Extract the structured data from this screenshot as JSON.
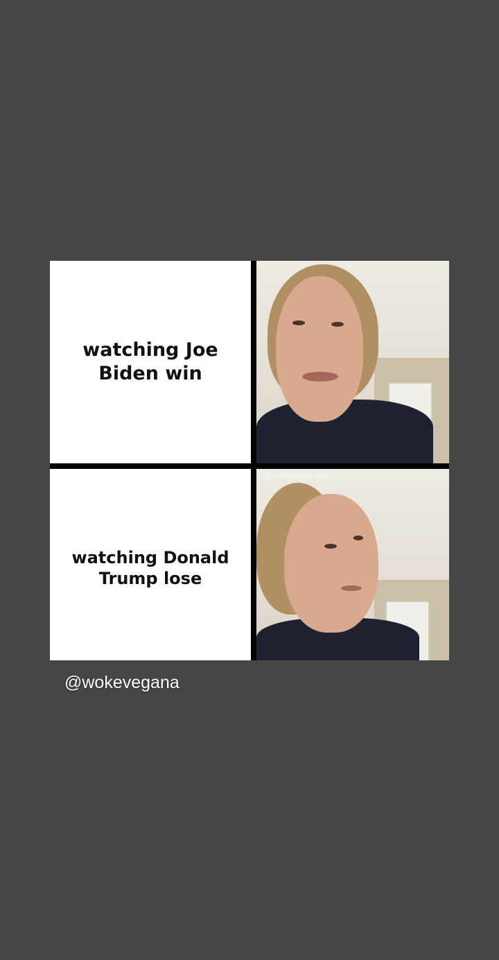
{
  "meme": {
    "top_caption": "watching Joe Biden win",
    "bottom_caption": "watching Donald Trump lose",
    "watermark": "@makegodgayagain"
  },
  "story": {
    "mention": "@wokevegana"
  }
}
